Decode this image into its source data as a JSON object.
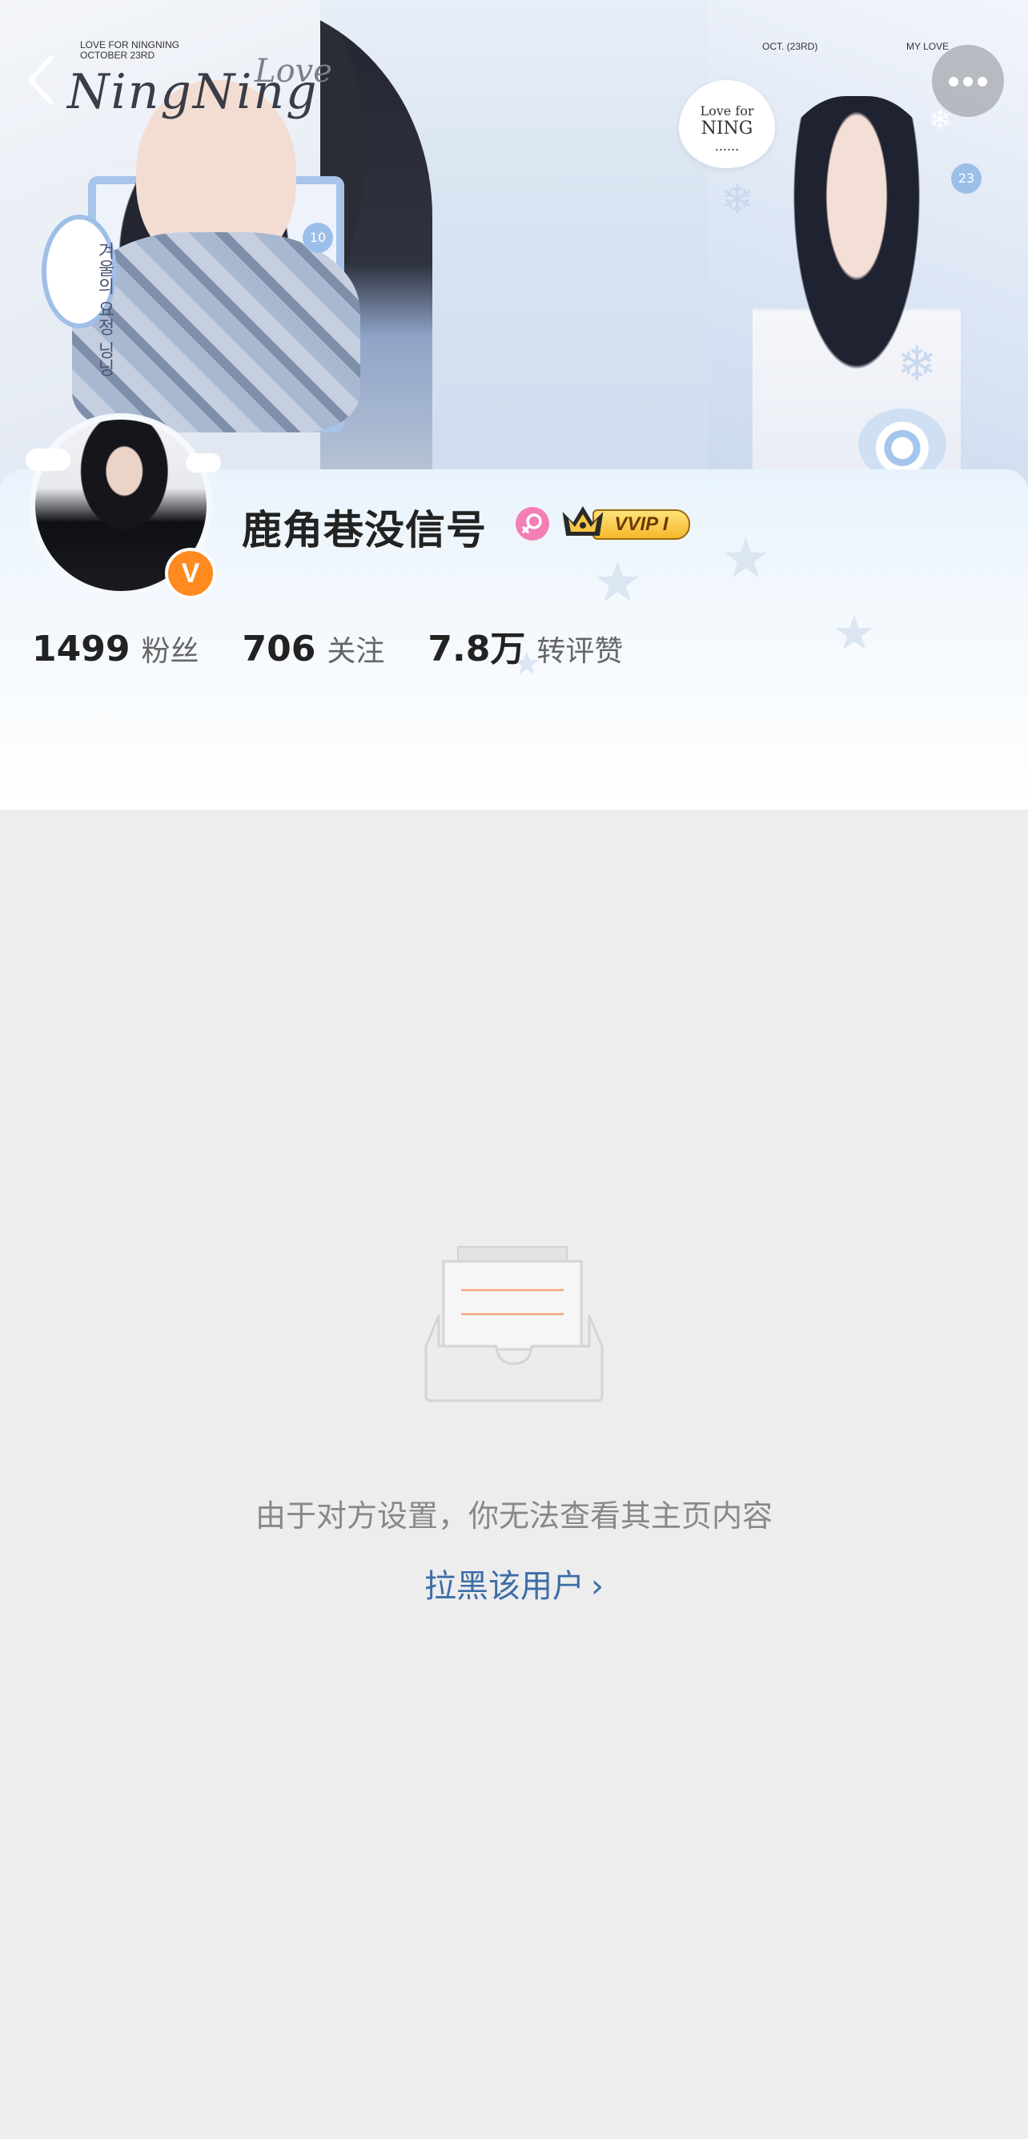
{
  "banner": {
    "small_top_left_line1": "LOVE FOR NINGNING",
    "small_top_left_line2": "OCTOBER 23RD",
    "small_top_center": "OCT. (23RD)",
    "small_top_right": "MY LOVE",
    "script_love": "Love",
    "script_name": "NingNing",
    "heart_line1": "Love for",
    "heart_line2": "NING",
    "heart_line3": "......",
    "tag_text": "겨울의 요정 닝닝",
    "num_left": "10",
    "num_right": "23"
  },
  "nav": {
    "back_icon": "back-arrow-icon",
    "more_icon": "more-dots-icon"
  },
  "profile": {
    "username": "鹿角巷没信号",
    "gender_icon": "female-icon",
    "vip_label": "VVIP I",
    "verified_badge": "V",
    "verified_color": "#ff8a1f"
  },
  "stats": [
    {
      "value": "1499",
      "label": "粉丝"
    },
    {
      "value": "706",
      "label": "关注"
    },
    {
      "value": "7.8万",
      "label": "转评赞"
    }
  ],
  "empty_state": {
    "message": "由于对方设置，你无法查看其主页内容",
    "block_link": "拉黑该用户",
    "link_chevron": "›",
    "link_color": "#3d6da8"
  }
}
